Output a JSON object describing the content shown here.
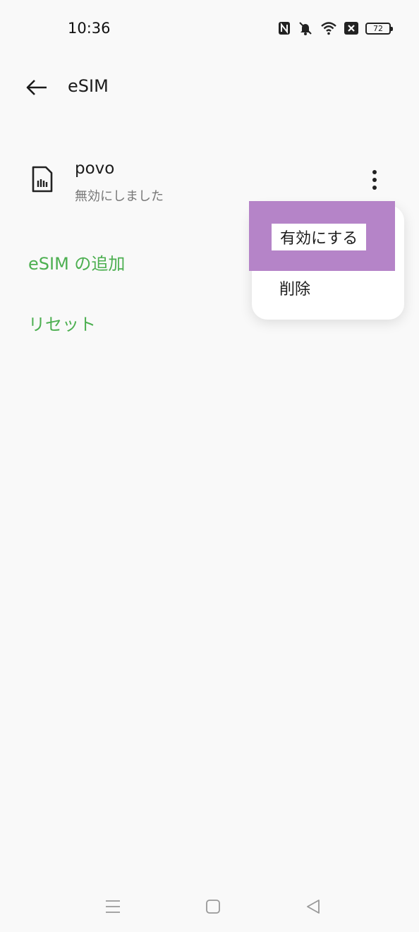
{
  "status_bar": {
    "time": "10:36",
    "battery_level": "72",
    "icons": [
      "nfc-icon",
      "mute-icon",
      "wifi-icon",
      "no-sim-icon",
      "battery-icon"
    ]
  },
  "header": {
    "title": "eSIM",
    "back_icon": "arrow-left-icon"
  },
  "esim": {
    "name": "povo",
    "status": "無効にしました",
    "icon": "sim-card-icon",
    "more_icon": "more-vertical-icon"
  },
  "actions": {
    "add_esim": "eSIM の追加",
    "reset": "リセット"
  },
  "popup_menu": {
    "items": [
      {
        "label": "有効にする",
        "highlighted": true
      },
      {
        "label": "削除",
        "highlighted": false
      }
    ]
  },
  "nav_bar": {
    "icons": [
      "menu-icon",
      "home-icon",
      "back-triangle-icon"
    ]
  },
  "colors": {
    "accent_green": "#4caf50",
    "highlight_purple": "#b584c8",
    "background": "#f9f9f9"
  }
}
